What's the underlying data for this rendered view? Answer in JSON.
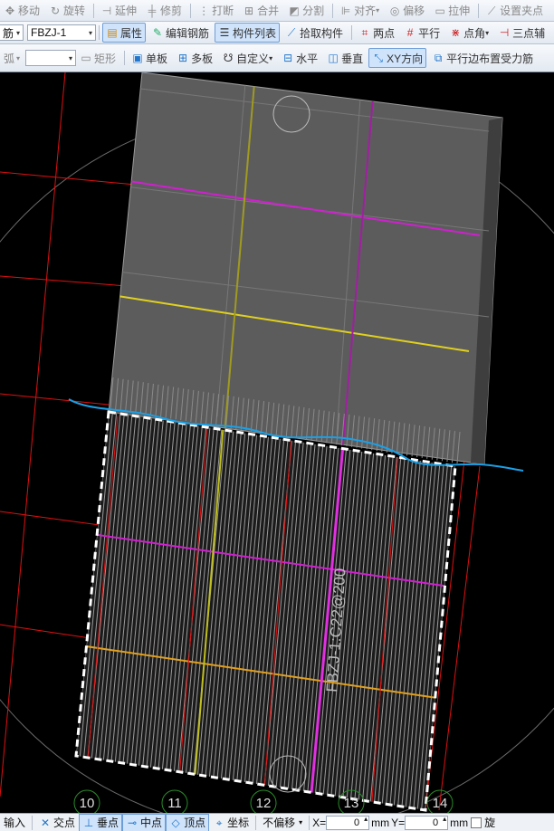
{
  "toolbar_top": {
    "move": "移动",
    "rotate": "旋转",
    "extend": "延伸",
    "trim": "修剪",
    "break": "打断",
    "merge": "合并",
    "split": "分割",
    "align": "对齐",
    "offset": "偏移",
    "stretch": "拉伸",
    "set_grip": "设置夹点"
  },
  "toolbar_mid": {
    "category_partial": "筋",
    "component_name": "FBZJ-1",
    "properties": "属性",
    "edit_rebar": "编辑钢筋",
    "component_list": "构件列表",
    "pick_component": "拾取构件",
    "two_points": "两点",
    "parallel": "平行",
    "point_angle": "点角",
    "three_point_partial": "三点辅"
  },
  "toolbar_draw": {
    "arc_partial": "弧",
    "rectangle": "矩形",
    "single_slab": "单板",
    "multi_slab": "多板",
    "custom": "自定义",
    "horizontal": "水平",
    "vertical": "垂直",
    "xy_direction": "XY方向",
    "parallel_edge": "平行边布置受力筋"
  },
  "canvas": {
    "rebar_label": "FBZJ-1:C22@200",
    "axis_labels": [
      "10",
      "11",
      "12",
      "13",
      "14"
    ],
    "colors": {
      "slab_fill": "#5c5c5c",
      "grid_red": "#e01010",
      "magenta": "#d020d0",
      "yellow": "#e0d020",
      "blue_annotation": "#1aa0e6",
      "dashed_white": "#ffffff"
    }
  },
  "status_bar": {
    "input_partial": "输入",
    "intersection": "交点",
    "perpendicular": "垂点",
    "midpoint": "中点",
    "vertex": "顶点",
    "coordinate": "坐标",
    "no_offset": "不偏移",
    "x_label": "X=",
    "x_value": "0",
    "y_label": "Y=",
    "y_value": "0",
    "unit": "mm",
    "unit2": "mm",
    "rotate_partial": "旋"
  }
}
